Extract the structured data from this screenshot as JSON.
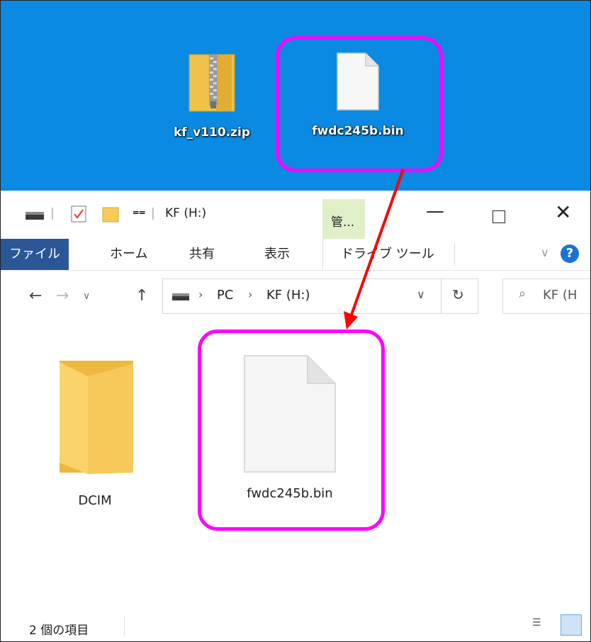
{
  "desktop": {
    "icons": [
      {
        "label": "kf_v110.zip",
        "icon": "zip-folder-icon"
      },
      {
        "label": "fwdc245b.bin",
        "icon": "file-icon"
      }
    ]
  },
  "explorer": {
    "title": "KF (H:)",
    "contextual_tab": "管...",
    "tabs": [
      "ファイル",
      "ホーム",
      "共有",
      "表示",
      "ドライブ ツール"
    ],
    "breadcrumb": [
      "PC",
      "KF (H:)"
    ],
    "search_placeholder": "KF (H",
    "items": [
      {
        "label": "DCIM",
        "icon": "folder-icon"
      },
      {
        "label": "fwdc245b.bin",
        "icon": "file-icon"
      }
    ],
    "status": "2 個の項目"
  },
  "colors": {
    "desktop": "#0a8ae3",
    "highlight": "#ff00ff",
    "arrow": "#ff0000",
    "file_tab": "#2b5797",
    "context_tab": "#dff0c8"
  }
}
